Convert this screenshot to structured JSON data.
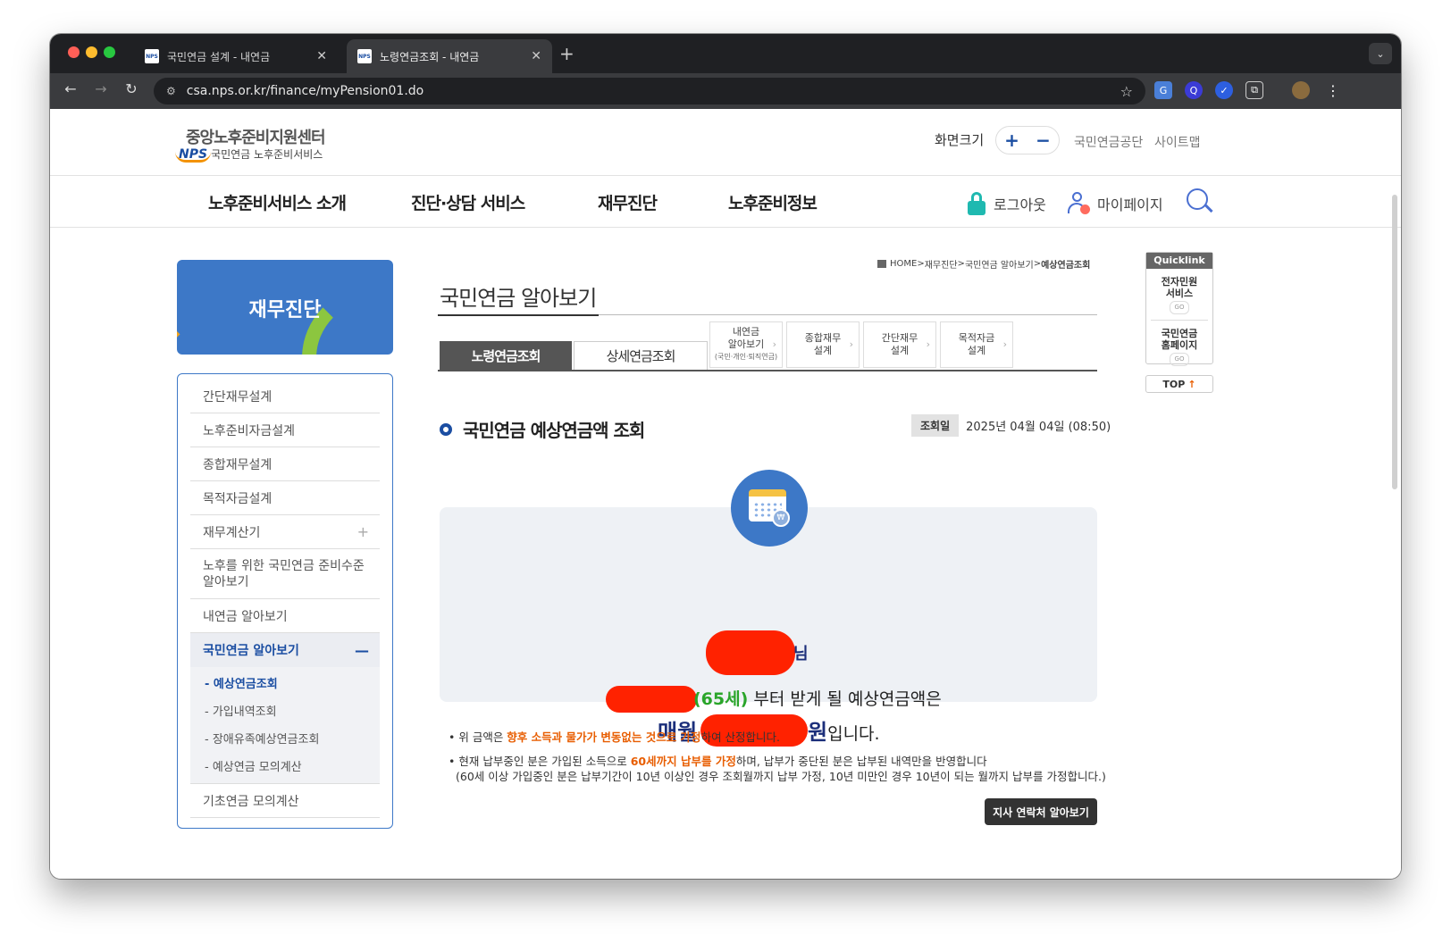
{
  "browser": {
    "tabs": [
      {
        "title": "국민연금 설계 - 내연금",
        "active": false
      },
      {
        "title": "노령연금조회 - 내연금",
        "active": true
      }
    ],
    "url": "csa.nps.or.kr/finance/myPension01.do"
  },
  "header": {
    "logo_main": "중앙노후준비지원센터",
    "logo_nps": "NPS",
    "logo_sub": "국민연금 노후준비서비스",
    "fontsize_label": "화면크기",
    "fontsize_plus": "+",
    "fontsize_minus": "−",
    "links": [
      "국민연금공단",
      "사이트맵"
    ]
  },
  "gnb": {
    "items": [
      "노후준비서비스 소개",
      "진단·상담 서비스",
      "재무진단",
      "노후준비정보"
    ],
    "logout": "로그아웃",
    "mypage": "마이페이지"
  },
  "sidebar": {
    "banner_title": "재무진단",
    "items": [
      "간단재무설계",
      "노후준비자금설계",
      "종합재무설계",
      "목적자금설계",
      "재무계산기",
      "노후를 위한 국민연금 준비수준 알아보기",
      "내연금 알아보기",
      "국민연금 알아보기",
      "기초연금 모의계산"
    ],
    "subitems": [
      "- 예상연금조회",
      "- 가입내역조회",
      "- 장애유족예상연금조회",
      "- 예상연금 모의계산"
    ]
  },
  "breadcrumb": {
    "home": "HOME",
    "sep": " > ",
    "path": [
      "재무진단",
      "국민연금 알아보기"
    ],
    "current": "예상연금조회"
  },
  "main": {
    "page_title": "국민연금 알아보기",
    "tabs": {
      "main_on": "노령연금조회",
      "main_off": "상세연금조회",
      "small": [
        {
          "line1": "내연금",
          "line2": "알아보기",
          "tiny": "(국민·개인·퇴직연금)"
        },
        {
          "line1": "종합재무",
          "line2": "설계"
        },
        {
          "line1": "간단재무",
          "line2": "설계"
        },
        {
          "line1": "목적자금",
          "line2": "설계"
        }
      ]
    },
    "section_title": "국민연금 예상연금액 조회",
    "date_label": "조회일",
    "date_value": "2025년 04월 04일 (08:50)",
    "result": {
      "name_suffix": "님",
      "age": "(65세)",
      "line2_text": " 부터 받게 될 예상연금액은",
      "monthly": "매월",
      "won": "원",
      "line3_end": "입니다."
    },
    "notes": {
      "n1_a": "• 위 금액은 ",
      "n1_hl": "향후 소득과 물가가 변동없는 것으로 가정",
      "n1_b": "하여 산정합니다.",
      "n2_a": "• 현재 납부중인 분은 가입된 소득으로 ",
      "n2_hl": "60세까지 납부를 가정",
      "n2_b": "하며, 납부가 중단된 분은 납부된 내역만을 반영합니다",
      "n2_c": "(60세 이상 가입중인 분은 납부기간이 10년 이상인 경우 조회월까지 납부 가정, 10년 미만인 경우 10년이 되는 월까지 납부를 가정합니다.)"
    },
    "branch_button": "지사 연락처 알아보기"
  },
  "quicklink": {
    "head": "Quicklink",
    "items": [
      {
        "line1": "전자민원",
        "line2": "서비스",
        "go": "GO"
      },
      {
        "line1": "국민연금",
        "line2": "홈페이지",
        "go": "GO"
      }
    ],
    "top": "TOP",
    "top_arrow": "↑"
  }
}
